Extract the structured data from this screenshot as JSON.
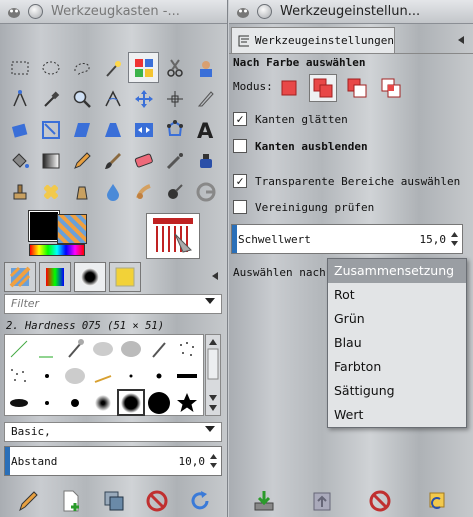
{
  "toolbox": {
    "title": "Werkzeugkasten -...",
    "filter_placeholder": "Filter",
    "brush_name": "2. Hardness 075 (51 × 51)",
    "brush_set": "Basic,",
    "spacing": {
      "label": "Abstand",
      "value": "10,0"
    }
  },
  "options": {
    "title": "Werkzeugeinstellun...",
    "tab_label": "Werkzeugeinstellungen",
    "heading": "Nach Farbe auswählen",
    "modus_label": "Modus:",
    "checkboxes": [
      {
        "label": "Kanten glätten",
        "checked": true
      },
      {
        "label": "Kanten ausblenden",
        "checked": false
      },
      {
        "label": "Transparente Bereiche auswählen",
        "checked": true
      },
      {
        "label": "Vereinigung prüfen",
        "checked": false
      }
    ],
    "threshold": {
      "label": "Schwellwert",
      "value": "15,0"
    },
    "select_by_label": "Auswählen nach:",
    "select_by_options": [
      "Zusammensetzung",
      "Rot",
      "Grün",
      "Blau",
      "Farbton",
      "Sättigung",
      "Wert"
    ],
    "select_by_highlighted": "Zusammensetzung"
  }
}
